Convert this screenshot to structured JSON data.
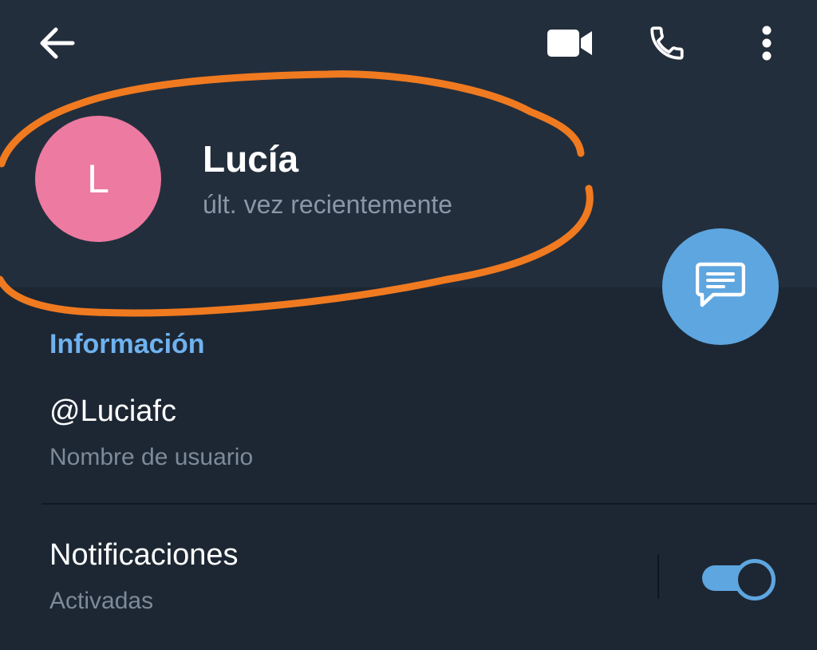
{
  "toolbar": {
    "icons": [
      "arrow-left-icon",
      "video-camera-icon",
      "phone-icon",
      "more-vertical-icon"
    ]
  },
  "profile": {
    "avatar_initial": "L",
    "name": "Lucía",
    "status": "últ. vez recientemente"
  },
  "fab": {
    "icon": "message-icon"
  },
  "info": {
    "section_title": "Información",
    "username": "@Luciafc",
    "username_caption": "Nombre de usuario"
  },
  "notifications": {
    "label": "Notificaciones",
    "status": "Activadas",
    "enabled": true
  },
  "colors": {
    "background": "#1d2733",
    "header": "#232e3c",
    "accent": "#5ea6e0",
    "section_title": "#6fb2ef",
    "avatar": "#ed7aa0",
    "annotation": "#f07a20"
  }
}
